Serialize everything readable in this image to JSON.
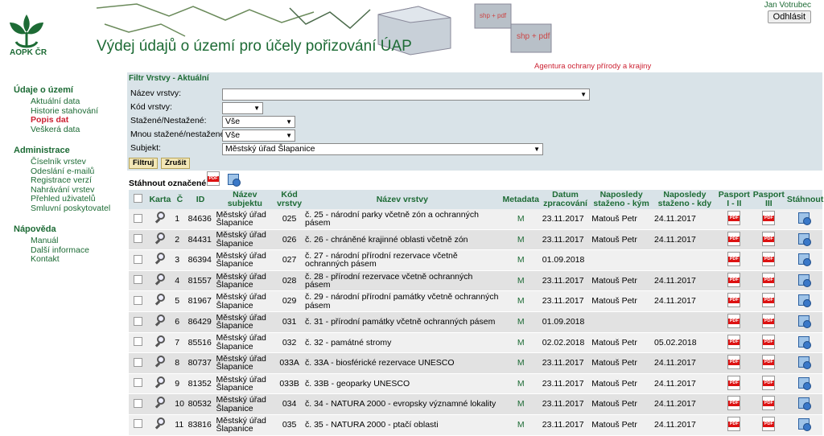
{
  "header": {
    "logo_text": "AOPK ČR",
    "title": "Výdej údajů o území pro účely pořizování ÚAP",
    "agency": "Agentura ochrany přírody a krajiny",
    "user": "Jan Votrubec",
    "logout_label": "Odhlásit",
    "box_label": "shp + pdf",
    "box_label2": "shp + pdf"
  },
  "sidebar": {
    "sections": [
      {
        "heading": "Údaje o území",
        "items": [
          "Aktuální data",
          "Historie stahování",
          "Popis dat",
          "Veškerá data"
        ]
      },
      {
        "heading": "Administrace",
        "items": [
          "Číselník vrstev",
          "Odeslání e-mailů",
          "Registrace verzí",
          "Nahrávání vrstev",
          "Přehled uživatelů",
          "Smluvní poskytovatel"
        ]
      },
      {
        "heading": "Nápověda",
        "items": [
          "Manuál",
          "Další informace",
          "Kontakt"
        ]
      }
    ],
    "active_item": "Popis dat"
  },
  "filter": {
    "title": "Filtr Vrstvy - Aktuální",
    "layer_name_label": "Název vrstvy:",
    "layer_name_value": "",
    "layer_code_label": "Kód vrstvy:",
    "layer_code_value": "",
    "downloaded_label": "Stažené/Nestažené:",
    "downloaded_value": "Vše",
    "my_downloaded_label": "Mnou stažené/nestažené:",
    "my_downloaded_value": "Vše",
    "subject_label": "Subjekt:",
    "subject_value": "Městský úřad Šlapanice",
    "filter_button": "Filtruj",
    "cancel_button": "Zrušit"
  },
  "download_marked_label": "Stáhnout označené:",
  "table": {
    "columns": [
      "Karta",
      "Č",
      "ID",
      "Název subjektu",
      "Kód vrstvy",
      "Název vrstvy",
      "Metadata",
      "Datum zpracování",
      "Naposledy staženo - kým",
      "Naposledy staženo - kdy",
      "Pasport I - II",
      "Pasport III",
      "Stáhnout"
    ],
    "rows": [
      {
        "n": "1",
        "id": "84636",
        "subject": "Městský úřad Šlapanice",
        "code": "025",
        "name": "č. 25 - národní parky včetně zón a ochranných pásem",
        "meta": "M",
        "date": "23.11.2017",
        "by": "Matouš Petr",
        "when": "24.11.2017"
      },
      {
        "n": "2",
        "id": "84431",
        "subject": "Městský úřad Šlapanice",
        "code": "026",
        "name": "č. 26 - chráněné krajinné oblasti včetně zón",
        "meta": "M",
        "date": "23.11.2017",
        "by": "Matouš Petr",
        "when": "24.11.2017"
      },
      {
        "n": "3",
        "id": "86394",
        "subject": "Městský úřad Šlapanice",
        "code": "027",
        "name": "č. 27 - národní přírodní rezervace včetně ochranných pásem",
        "meta": "M",
        "date": "01.09.2018",
        "by": "",
        "when": ""
      },
      {
        "n": "4",
        "id": "81557",
        "subject": "Městský úřad Šlapanice",
        "code": "028",
        "name": "č. 28 - přírodní rezervace včetně ochranných pásem",
        "meta": "M",
        "date": "23.11.2017",
        "by": "Matouš Petr",
        "when": "24.11.2017"
      },
      {
        "n": "5",
        "id": "81967",
        "subject": "Městský úřad Šlapanice",
        "code": "029",
        "name": "č. 29 - národní přírodní památky včetně ochranných pásem",
        "meta": "M",
        "date": "23.11.2017",
        "by": "Matouš Petr",
        "when": "24.11.2017"
      },
      {
        "n": "6",
        "id": "86429",
        "subject": "Městský úřad Šlapanice",
        "code": "031",
        "name": "č. 31 - přírodní památky včetně ochranných pásem",
        "meta": "M",
        "date": "01.09.2018",
        "by": "",
        "when": ""
      },
      {
        "n": "7",
        "id": "85516",
        "subject": "Městský úřad Šlapanice",
        "code": "032",
        "name": "č. 32 - památné stromy",
        "meta": "M",
        "date": "02.02.2018",
        "by": "Matouš Petr",
        "when": "05.02.2018"
      },
      {
        "n": "8",
        "id": "80737",
        "subject": "Městský úřad Šlapanice",
        "code": "033A",
        "name": "č. 33A - biosférické rezervace UNESCO",
        "meta": "M",
        "date": "23.11.2017",
        "by": "Matouš Petr",
        "when": "24.11.2017"
      },
      {
        "n": "9",
        "id": "81352",
        "subject": "Městský úřad Šlapanice",
        "code": "033B",
        "name": "č. 33B - geoparky UNESCO",
        "meta": "M",
        "date": "23.11.2017",
        "by": "Matouš Petr",
        "when": "24.11.2017"
      },
      {
        "n": "10",
        "id": "80532",
        "subject": "Městský úřad Šlapanice",
        "code": "034",
        "name": "č. 34 - NATURA 2000 - evropsky významné lokality",
        "meta": "M",
        "date": "23.11.2017",
        "by": "Matouš Petr",
        "when": "24.11.2017"
      },
      {
        "n": "11",
        "id": "83816",
        "subject": "Městský úřad Šlapanice",
        "code": "035",
        "name": "č. 35 - NATURA 2000 - ptačí oblasti",
        "meta": "M",
        "date": "23.11.2017",
        "by": "Matouš Petr",
        "when": "24.11.2017"
      }
    ]
  }
}
